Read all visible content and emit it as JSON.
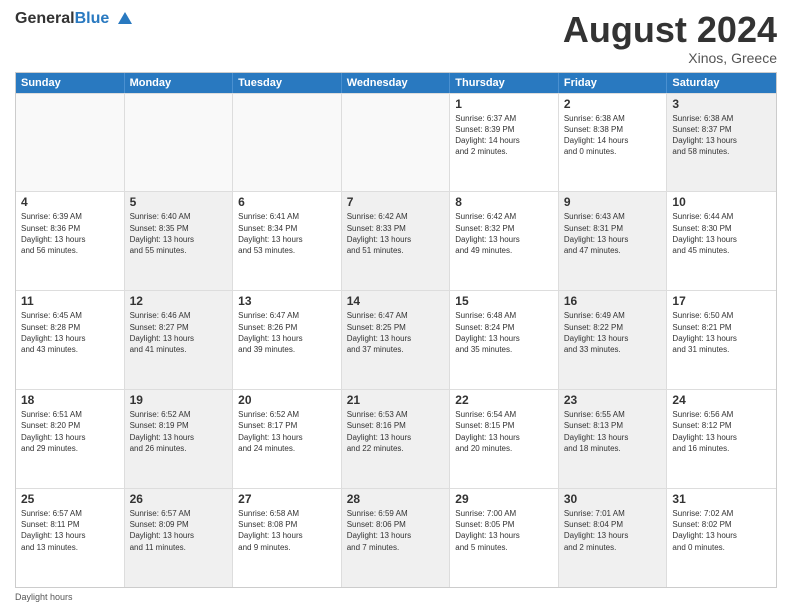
{
  "logo": {
    "general": "General",
    "blue": "Blue"
  },
  "title": "August 2024",
  "subtitle": "Xinos, Greece",
  "header_days": [
    "Sunday",
    "Monday",
    "Tuesday",
    "Wednesday",
    "Thursday",
    "Friday",
    "Saturday"
  ],
  "footer": "Daylight hours",
  "weeks": [
    [
      {
        "day": "",
        "info": "",
        "empty": true
      },
      {
        "day": "",
        "info": "",
        "empty": true
      },
      {
        "day": "",
        "info": "",
        "empty": true
      },
      {
        "day": "",
        "info": "",
        "empty": true
      },
      {
        "day": "1",
        "info": "Sunrise: 6:37 AM\nSunset: 8:39 PM\nDaylight: 14 hours\nand 2 minutes."
      },
      {
        "day": "2",
        "info": "Sunrise: 6:38 AM\nSunset: 8:38 PM\nDaylight: 14 hours\nand 0 minutes."
      },
      {
        "day": "3",
        "info": "Sunrise: 6:38 AM\nSunset: 8:37 PM\nDaylight: 13 hours\nand 58 minutes.",
        "shaded": true
      }
    ],
    [
      {
        "day": "4",
        "info": "Sunrise: 6:39 AM\nSunset: 8:36 PM\nDaylight: 13 hours\nand 56 minutes."
      },
      {
        "day": "5",
        "info": "Sunrise: 6:40 AM\nSunset: 8:35 PM\nDaylight: 13 hours\nand 55 minutes.",
        "shaded": true
      },
      {
        "day": "6",
        "info": "Sunrise: 6:41 AM\nSunset: 8:34 PM\nDaylight: 13 hours\nand 53 minutes."
      },
      {
        "day": "7",
        "info": "Sunrise: 6:42 AM\nSunset: 8:33 PM\nDaylight: 13 hours\nand 51 minutes.",
        "shaded": true
      },
      {
        "day": "8",
        "info": "Sunrise: 6:42 AM\nSunset: 8:32 PM\nDaylight: 13 hours\nand 49 minutes."
      },
      {
        "day": "9",
        "info": "Sunrise: 6:43 AM\nSunset: 8:31 PM\nDaylight: 13 hours\nand 47 minutes.",
        "shaded": true
      },
      {
        "day": "10",
        "info": "Sunrise: 6:44 AM\nSunset: 8:30 PM\nDaylight: 13 hours\nand 45 minutes."
      }
    ],
    [
      {
        "day": "11",
        "info": "Sunrise: 6:45 AM\nSunset: 8:28 PM\nDaylight: 13 hours\nand 43 minutes."
      },
      {
        "day": "12",
        "info": "Sunrise: 6:46 AM\nSunset: 8:27 PM\nDaylight: 13 hours\nand 41 minutes.",
        "shaded": true
      },
      {
        "day": "13",
        "info": "Sunrise: 6:47 AM\nSunset: 8:26 PM\nDaylight: 13 hours\nand 39 minutes."
      },
      {
        "day": "14",
        "info": "Sunrise: 6:47 AM\nSunset: 8:25 PM\nDaylight: 13 hours\nand 37 minutes.",
        "shaded": true
      },
      {
        "day": "15",
        "info": "Sunrise: 6:48 AM\nSunset: 8:24 PM\nDaylight: 13 hours\nand 35 minutes."
      },
      {
        "day": "16",
        "info": "Sunrise: 6:49 AM\nSunset: 8:22 PM\nDaylight: 13 hours\nand 33 minutes.",
        "shaded": true
      },
      {
        "day": "17",
        "info": "Sunrise: 6:50 AM\nSunset: 8:21 PM\nDaylight: 13 hours\nand 31 minutes."
      }
    ],
    [
      {
        "day": "18",
        "info": "Sunrise: 6:51 AM\nSunset: 8:20 PM\nDaylight: 13 hours\nand 29 minutes."
      },
      {
        "day": "19",
        "info": "Sunrise: 6:52 AM\nSunset: 8:19 PM\nDaylight: 13 hours\nand 26 minutes.",
        "shaded": true
      },
      {
        "day": "20",
        "info": "Sunrise: 6:52 AM\nSunset: 8:17 PM\nDaylight: 13 hours\nand 24 minutes."
      },
      {
        "day": "21",
        "info": "Sunrise: 6:53 AM\nSunset: 8:16 PM\nDaylight: 13 hours\nand 22 minutes.",
        "shaded": true
      },
      {
        "day": "22",
        "info": "Sunrise: 6:54 AM\nSunset: 8:15 PM\nDaylight: 13 hours\nand 20 minutes."
      },
      {
        "day": "23",
        "info": "Sunrise: 6:55 AM\nSunset: 8:13 PM\nDaylight: 13 hours\nand 18 minutes.",
        "shaded": true
      },
      {
        "day": "24",
        "info": "Sunrise: 6:56 AM\nSunset: 8:12 PM\nDaylight: 13 hours\nand 16 minutes."
      }
    ],
    [
      {
        "day": "25",
        "info": "Sunrise: 6:57 AM\nSunset: 8:11 PM\nDaylight: 13 hours\nand 13 minutes."
      },
      {
        "day": "26",
        "info": "Sunrise: 6:57 AM\nSunset: 8:09 PM\nDaylight: 13 hours\nand 11 minutes.",
        "shaded": true
      },
      {
        "day": "27",
        "info": "Sunrise: 6:58 AM\nSunset: 8:08 PM\nDaylight: 13 hours\nand 9 minutes."
      },
      {
        "day": "28",
        "info": "Sunrise: 6:59 AM\nSunset: 8:06 PM\nDaylight: 13 hours\nand 7 minutes.",
        "shaded": true
      },
      {
        "day": "29",
        "info": "Sunrise: 7:00 AM\nSunset: 8:05 PM\nDaylight: 13 hours\nand 5 minutes."
      },
      {
        "day": "30",
        "info": "Sunrise: 7:01 AM\nSunset: 8:04 PM\nDaylight: 13 hours\nand 2 minutes.",
        "shaded": true
      },
      {
        "day": "31",
        "info": "Sunrise: 7:02 AM\nSunset: 8:02 PM\nDaylight: 13 hours\nand 0 minutes."
      }
    ]
  ]
}
